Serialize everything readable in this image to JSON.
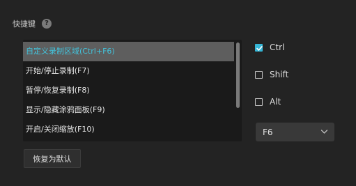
{
  "section": {
    "title": "快捷键",
    "help_icon": "question-icon"
  },
  "shortcut_list": {
    "items": [
      {
        "label": "自定义录制区域(Ctrl+F6)",
        "selected": true
      },
      {
        "label": "开始/停止录制(F7)",
        "selected": false
      },
      {
        "label": "暂停/恢复录制(F8)",
        "selected": false
      },
      {
        "label": "显示/隐藏涂鸦面板(F9)",
        "selected": false
      },
      {
        "label": "开启/关闭缩放(F10)",
        "selected": false
      }
    ]
  },
  "modifiers": {
    "ctrl": {
      "label": "Ctrl",
      "checked": true
    },
    "shift": {
      "label": "Shift",
      "checked": false
    },
    "alt": {
      "label": "Alt",
      "checked": false
    }
  },
  "key_select": {
    "value": "F6"
  },
  "reset_label": "恢复为默认",
  "colors": {
    "accent": "#35b6d6",
    "selected_text": "#43c3dc",
    "background": "#232323"
  }
}
